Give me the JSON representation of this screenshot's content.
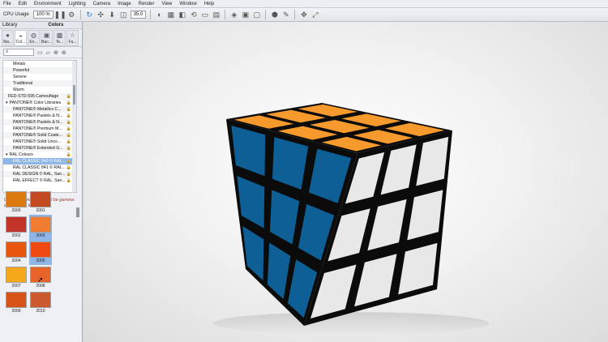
{
  "menu": [
    "File",
    "Edit",
    "Environment",
    "Lighting",
    "Camera",
    "Image",
    "Render",
    "View",
    "Window",
    "Help"
  ],
  "toolbar": {
    "cpu_label": "CPU Usage",
    "cpu_value": "100 %",
    "field_value": "35.0"
  },
  "library": {
    "panel_title": "Library",
    "colors_title": "Colors",
    "tabs": [
      "Ma...",
      "Col...",
      "En...",
      "Bac...",
      "Te...",
      "Fa..."
    ],
    "tree": [
      {
        "label": "Metals",
        "indent": 12
      },
      {
        "label": "Powerful",
        "indent": 12
      },
      {
        "label": "Serene",
        "indent": 12
      },
      {
        "label": "Traditional",
        "indent": 12
      },
      {
        "label": "Warm",
        "indent": 12
      },
      {
        "label": "FED-STD-595 Camouflage",
        "indent": 6,
        "lock": true
      },
      {
        "label": "PANTONE® Color Libraries",
        "indent": 3,
        "lock": true,
        "expander": "▾"
      },
      {
        "label": "PANTONE® Metallics C...",
        "indent": 12,
        "lock": true
      },
      {
        "label": "PANTONE® Pastels & N...",
        "indent": 12,
        "lock": true
      },
      {
        "label": "PANTONE® Pastels & N...",
        "indent": 12,
        "lock": true
      },
      {
        "label": "PANTONE® Premium M...",
        "indent": 12,
        "lock": true
      },
      {
        "label": "PANTONE® Solid Coate...",
        "indent": 12,
        "lock": true
      },
      {
        "label": "PANTONE® Solid Unco...",
        "indent": 12,
        "lock": true
      },
      {
        "label": "PANTONE® Extended G...",
        "indent": 12,
        "lock": true
      },
      {
        "label": "RAL Colours",
        "indent": 3,
        "lock": true,
        "expander": "▾"
      },
      {
        "label": "RAL CLASSIC 840 © RAL...",
        "indent": 12,
        "lock": true,
        "selected": true
      },
      {
        "label": "RAL CLASSIC 841 © RAL...",
        "indent": 12,
        "lock": true
      },
      {
        "label": "RAL DESIGN © RAL, San...",
        "indent": 12,
        "lock": true
      },
      {
        "label": "RAL EFFECT © RAL, San...",
        "indent": 12,
        "lock": true
      }
    ],
    "note": "Color from the library will be gamma corrected in the image.",
    "swatches": [
      {
        "code": "2000",
        "color": "#dc7a0f"
      },
      {
        "code": "2001",
        "color": "#c24a23"
      },
      {
        "code": "2002",
        "color": "#c2342a"
      },
      {
        "code": "2003",
        "color": "#f07c32",
        "selected": true
      },
      {
        "code": "2004",
        "color": "#e8560e"
      },
      {
        "code": "2005",
        "color": "#f04a12",
        "selected": true
      },
      {
        "code": "2007",
        "color": "#f5a81a"
      },
      {
        "code": "2008",
        "color": "#e6642a"
      },
      {
        "code": "2009",
        "color": "#d85316"
      },
      {
        "code": "2010",
        "color": "#cc5a2e"
      }
    ]
  },
  "scene": {
    "top_color": "#f79a2e",
    "left_color": "#0d5f95",
    "right_color": "#e8e8e8",
    "edge_color": "#0b0b0b"
  }
}
